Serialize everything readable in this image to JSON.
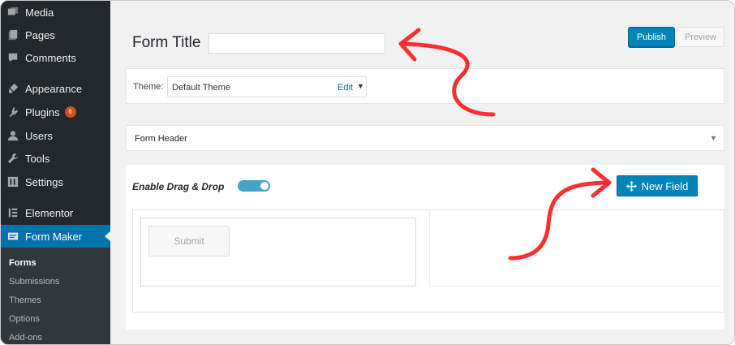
{
  "sidebar": {
    "items": [
      {
        "label": "Media",
        "icon": "media-icon"
      },
      {
        "label": "Pages",
        "icon": "pages-icon"
      },
      {
        "label": "Comments",
        "icon": "comments-icon"
      },
      {
        "label": "Appearance",
        "icon": "appearance-icon"
      },
      {
        "label": "Plugins",
        "icon": "plugins-icon",
        "badge": "6"
      },
      {
        "label": "Users",
        "icon": "users-icon"
      },
      {
        "label": "Tools",
        "icon": "tools-icon"
      },
      {
        "label": "Settings",
        "icon": "settings-icon"
      },
      {
        "label": "Elementor",
        "icon": "elementor-icon"
      },
      {
        "label": "Form Maker",
        "icon": "form-maker-icon",
        "active": true
      }
    ],
    "submenu": [
      "Forms",
      "Submissions",
      "Themes",
      "Options",
      "Add-ons"
    ],
    "current_submenu": "Forms"
  },
  "editor": {
    "title_label": "Form Title",
    "title_value": "",
    "publish_label": "Publish",
    "preview_label": "Preview",
    "theme": {
      "label": "Theme:",
      "selected": "Default Theme",
      "edit_label": "Edit",
      "caret": "▼"
    },
    "header_section": {
      "label": "Form Header",
      "toggle": "▼"
    },
    "drag_drop": {
      "label": "Enable Drag & Drop",
      "enabled": true
    },
    "new_field_label": "New Field",
    "submit_label": "Submit"
  },
  "colors": {
    "sidebar_bg": "#23282d",
    "active_blue": "#0073aa",
    "button_blue": "#0085ba",
    "annotation_red": "#ff2d2d",
    "badge": "#d54e21"
  }
}
